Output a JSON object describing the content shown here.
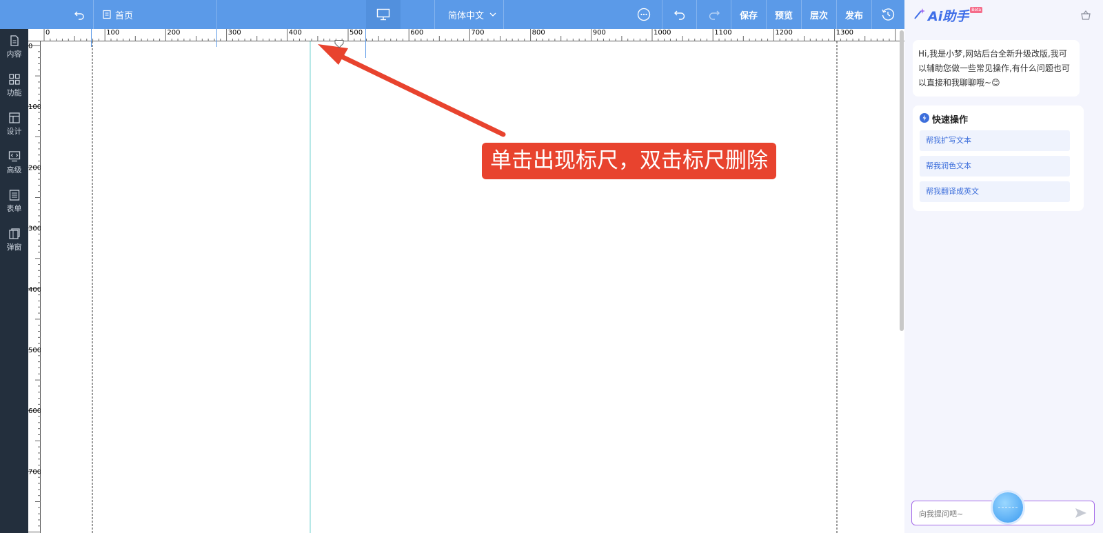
{
  "topbar": {
    "home_label": "首页",
    "language": "简体中文",
    "save": "保存",
    "preview": "预览",
    "layers": "层次",
    "publish": "发布"
  },
  "sidebar": {
    "items": [
      {
        "label": "内容",
        "icon": "document-icon"
      },
      {
        "label": "功能",
        "icon": "grid-icon"
      },
      {
        "label": "设计",
        "icon": "layout-icon"
      },
      {
        "label": "高级",
        "icon": "code-monitor-icon"
      },
      {
        "label": "表单",
        "icon": "form-icon"
      },
      {
        "label": "弹窗",
        "icon": "popup-icon"
      }
    ]
  },
  "ruler": {
    "top_labels": [
      "0",
      "100",
      "200",
      "300",
      "400",
      "500",
      "600",
      "700",
      "800",
      "900",
      "1000",
      "1100",
      "1200",
      "1300"
    ],
    "left_labels": [
      "0",
      "100",
      "200",
      "300",
      "400",
      "500",
      "600",
      "700"
    ]
  },
  "annotation": {
    "text": "单击出现标尺，双击标尺删除",
    "color": "#e8432e"
  },
  "ai": {
    "title": "Ai助手",
    "badge": "Beta",
    "greeting": "Hi,我是小梦,网站后台全新升级改版,我可以辅助您做一些常见操作,有什么问题也可以直接和我聊聊哦~",
    "emoji": "😊",
    "quick_title": "快速操作",
    "quick_items": [
      "帮我扩写文本",
      "帮我润色文本",
      "帮我翻译成英文"
    ],
    "input_placeholder": "向我提问吧~"
  },
  "colors": {
    "topbar": "#5b9ae8",
    "sidebar": "#232f3d",
    "accent": "#3c6edb"
  }
}
